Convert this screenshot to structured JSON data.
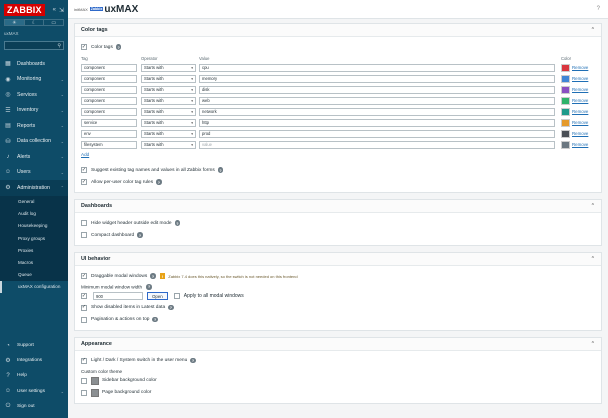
{
  "sidebar": {
    "logo": "ZABBIX",
    "server_name": "uxMAX",
    "nav": [
      {
        "label": "Dashboards",
        "icon": "dashboard-icon"
      },
      {
        "label": "Monitoring",
        "icon": "eye-icon"
      },
      {
        "label": "Services",
        "icon": "services-icon"
      },
      {
        "label": "Inventory",
        "icon": "inventory-icon"
      },
      {
        "label": "Reports",
        "icon": "reports-icon"
      },
      {
        "label": "Data collection",
        "icon": "data-collection-icon"
      },
      {
        "label": "Alerts",
        "icon": "bell-icon"
      },
      {
        "label": "Users",
        "icon": "users-icon"
      },
      {
        "label": "Administration",
        "icon": "gear-icon"
      }
    ],
    "admin_sub": [
      "General",
      "Audit log",
      "Housekeeping",
      "Proxy groups",
      "Proxies",
      "Macros",
      "Queue",
      "uxMAX configuration"
    ],
    "bottom": [
      {
        "label": "Support",
        "icon": "support-icon"
      },
      {
        "label": "Integrations",
        "icon": "integrations-icon"
      },
      {
        "label": "Help",
        "icon": "help-icon"
      },
      {
        "label": "User settings",
        "icon": "user-icon"
      },
      {
        "label": "Sign out",
        "icon": "power-icon"
      }
    ]
  },
  "header": {
    "brand_small": "initMAX",
    "brand_badge": "Zabbix",
    "title": "uxMAX",
    "help": "?"
  },
  "color_tags": {
    "title": "Color tags",
    "enable_label": "Color tags",
    "headers": {
      "tag": "Tag",
      "operator": "Operator",
      "value": "Value",
      "color": "Color"
    },
    "rows": [
      {
        "tag": "component",
        "operator": "Starts with",
        "value": "cpu",
        "color": "#d9363e",
        "remove": "Remove"
      },
      {
        "tag": "component",
        "operator": "Starts with",
        "value": "memory",
        "color": "#3f86d6",
        "remove": "Remove"
      },
      {
        "tag": "component",
        "operator": "Starts with",
        "value": "disk",
        "color": "#8a4fc2",
        "remove": "Remove"
      },
      {
        "tag": "component",
        "operator": "Starts with",
        "value": "web",
        "color": "#2fb26a",
        "remove": "Remove"
      },
      {
        "tag": "component",
        "operator": "Starts with",
        "value": "network",
        "color": "#1e9a8a",
        "remove": "Remove"
      },
      {
        "tag": "service",
        "operator": "Starts with",
        "value": "http",
        "color": "#e59a2b",
        "remove": "Remove"
      },
      {
        "tag": "env",
        "operator": "Starts with",
        "value": "prod",
        "color": "#4a4f55",
        "remove": "Remove"
      },
      {
        "tag": "filesystem",
        "operator": "Starts with",
        "value": "",
        "value_placeholder": "value",
        "color": "#6b7780",
        "remove": "Remove"
      }
    ],
    "add_label": "Add",
    "suggest_label": "Suggest existing tag names and values in all Zabbix forms",
    "per_user_label": "Allow per-user color tag rules"
  },
  "dashboards": {
    "title": "Dashboards",
    "hide_header_label": "Hide widget header outside edit mode",
    "compact_label": "Compact dashboard"
  },
  "ui_behavior": {
    "title": "UI behavior",
    "draggable_label": "Draggable modal windows",
    "draggable_note": "Zabbix 7.4 does this natively, so the switch is not needed on this frontend",
    "min_width_label": "Minimum modal window width",
    "min_width_value": "900",
    "open_label": "Open",
    "apply_all_label": "Apply to all modal windows",
    "show_disabled_label": "Show disabled items in Latest data",
    "pagination_label": "Pagination & actions on top"
  },
  "appearance": {
    "title": "Appearance",
    "switch_label": "Light / Dark / System switch in the user menu",
    "custom_theme_label": "Custom color theme",
    "sidebar_bg_label": "Sidebar background color",
    "page_bg_label": "Page background color"
  },
  "colors": {
    "sidebar": "#0e4c68",
    "accent": "#1f6fb5",
    "logo": "#d40000"
  }
}
